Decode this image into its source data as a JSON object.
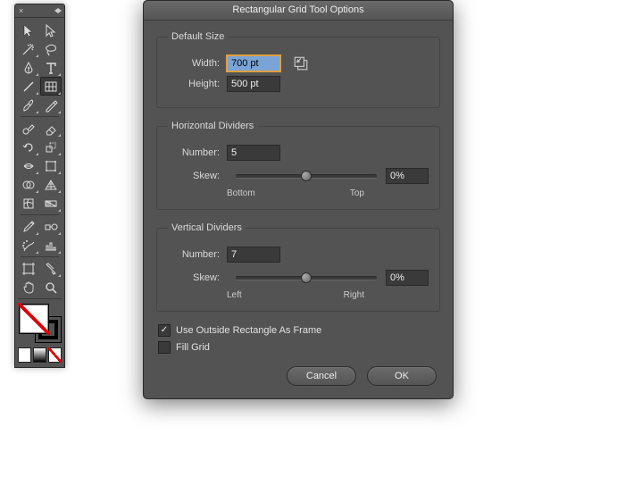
{
  "dialog": {
    "title": "Rectangular Grid Tool Options",
    "default_size": {
      "legend": "Default Size",
      "width_label": "Width:",
      "width_value": "700 pt",
      "height_label": "Height:",
      "height_value": "500 pt"
    },
    "horizontal": {
      "legend": "Horizontal Dividers",
      "number_label": "Number:",
      "number_value": "5",
      "skew_label": "Skew:",
      "skew_value": "0%",
      "left_label": "Bottom",
      "right_label": "Top"
    },
    "vertical": {
      "legend": "Vertical Dividers",
      "number_label": "Number:",
      "number_value": "7",
      "skew_label": "Skew:",
      "skew_value": "0%",
      "left_label": "Left",
      "right_label": "Right"
    },
    "options": {
      "use_frame": "Use Outside Rectangle As Frame",
      "fill_grid": "Fill Grid",
      "use_frame_checked": true,
      "fill_grid_checked": false
    },
    "buttons": {
      "cancel": "Cancel",
      "ok": "OK"
    }
  },
  "tools": {
    "items": [
      "selection-tool",
      "direct-selection-tool",
      "magic-wand-tool",
      "lasso-tool",
      "pen-tool",
      "type-tool",
      "line-segment-tool",
      "rectangular-grid-tool",
      "paintbrush-tool",
      "pencil-tool",
      "blob-brush-tool",
      "eraser-tool",
      "rotate-tool",
      "scale-tool",
      "width-tool",
      "free-transform-tool",
      "shape-builder-tool",
      "perspective-grid-tool",
      "mesh-tool",
      "gradient-tool",
      "eyedropper-tool",
      "blend-tool",
      "symbol-sprayer-tool",
      "column-graph-tool",
      "artboard-tool",
      "slice-tool",
      "hand-tool",
      "zoom-tool"
    ],
    "active_index": 7
  },
  "color_modes": [
    "solid-color",
    "gradient-color",
    "none-color"
  ]
}
